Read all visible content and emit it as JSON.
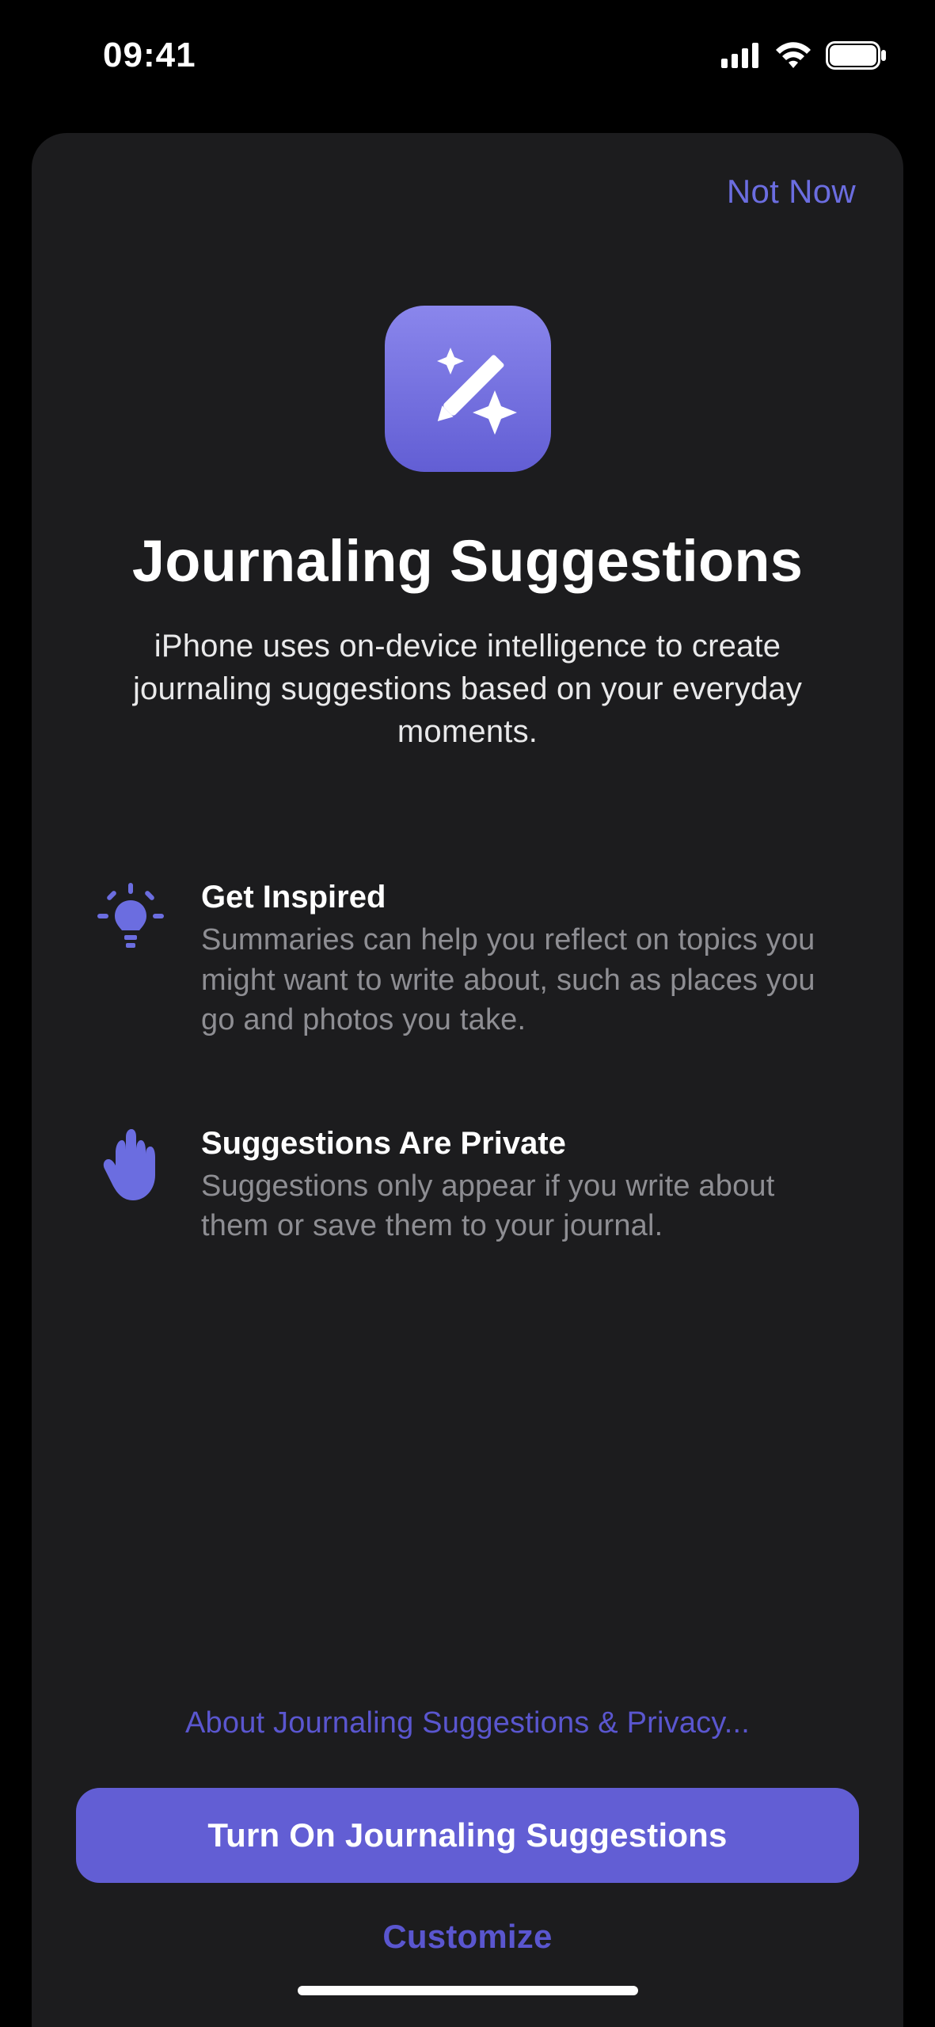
{
  "status": {
    "time": "09:41"
  },
  "sheet": {
    "not_now": "Not Now",
    "title": "Journaling Suggestions",
    "subtitle": "iPhone uses on-device intelligence to create journaling suggestions based on your everyday moments.",
    "features": [
      {
        "title": "Get Inspired",
        "body": "Summaries can help you reflect on topics you might want to write about, such as places you go and photos you take."
      },
      {
        "title": "Suggestions Are Private",
        "body": "Suggestions only appear if you write about them or save them to your journal."
      }
    ],
    "privacy_link": "About Journaling Suggestions & Privacy...",
    "primary_button": "Turn On Journaling Suggestions",
    "secondary_button": "Customize"
  }
}
